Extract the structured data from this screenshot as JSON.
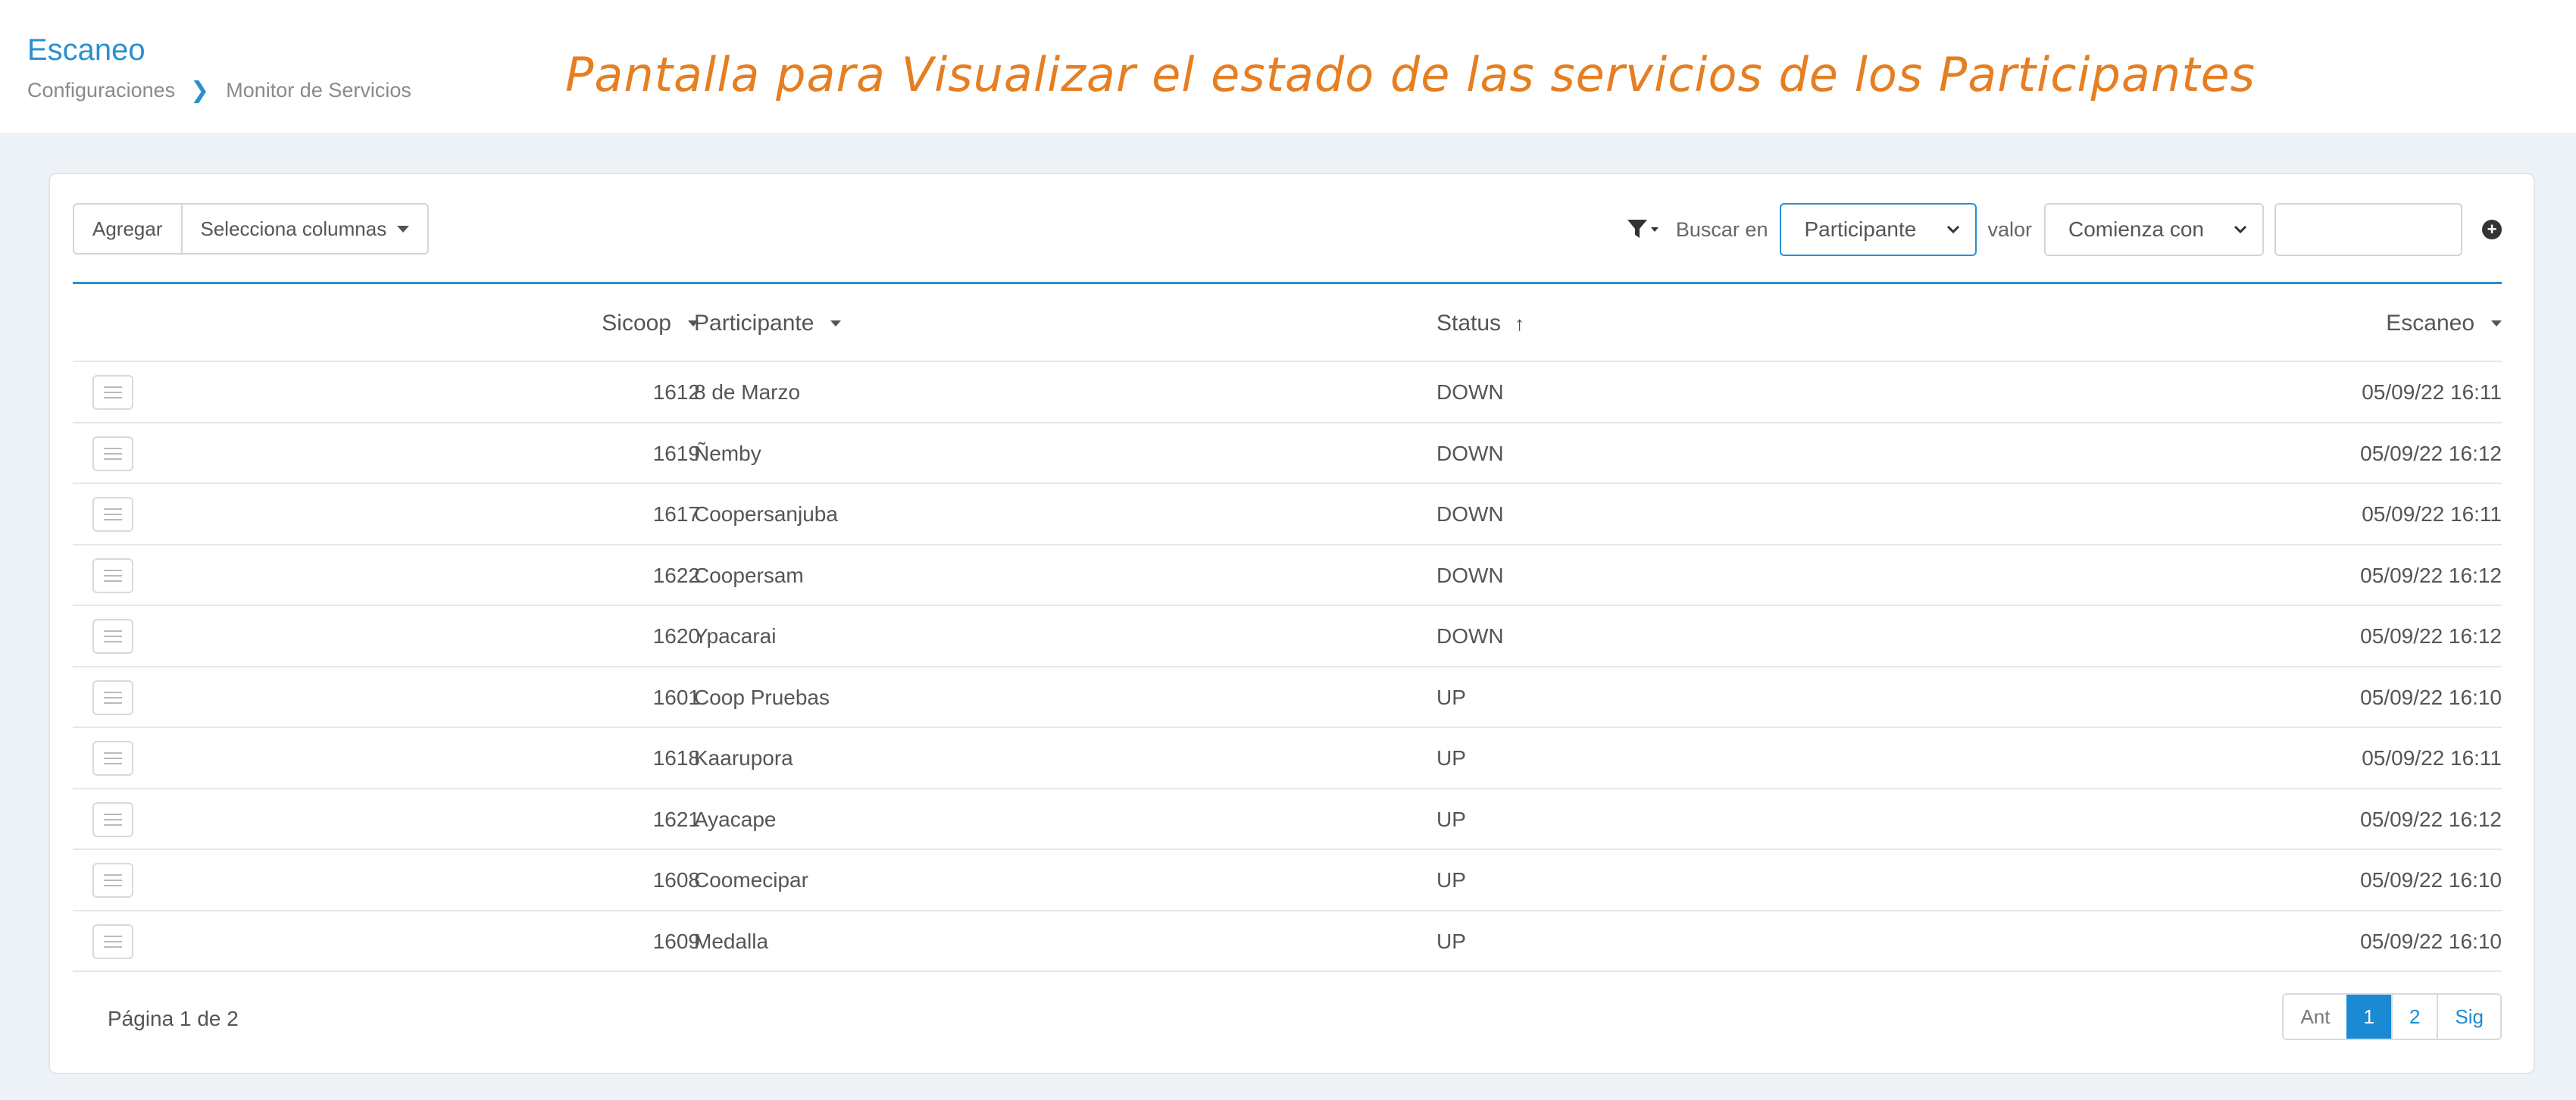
{
  "header": {
    "title": "Escaneo",
    "breadcrumb": [
      {
        "label": "Configuraciones"
      },
      {
        "label": "Monitor de Servicios"
      }
    ],
    "annotation": "Pantalla para Visualizar el estado de las servicios de los Participantes"
  },
  "toolbar": {
    "add_label": "Agregar",
    "columns_label": "Selecciona columnas",
    "search_in_label": "Buscar en",
    "search_field_value": "Participante",
    "value_label": "valor",
    "comparator_value": "Comienza con",
    "search_value": "",
    "icons": [
      "filter-icon",
      "chevron-down-icon",
      "plus-circle-icon"
    ]
  },
  "table": {
    "columns": [
      {
        "label": "Sicoop",
        "sort": "none"
      },
      {
        "label": "Participante",
        "sort": "none"
      },
      {
        "label": "Status",
        "sort": "asc"
      },
      {
        "label": "Escaneo",
        "sort": "none"
      }
    ],
    "rows": [
      {
        "sicoop": "1612",
        "participante": "8 de Marzo",
        "status": "DOWN",
        "escaneo": "05/09/22 16:11"
      },
      {
        "sicoop": "1619",
        "participante": "Ñemby",
        "status": "DOWN",
        "escaneo": "05/09/22 16:12"
      },
      {
        "sicoop": "1617",
        "participante": "Coopersanjuba",
        "status": "DOWN",
        "escaneo": "05/09/22 16:11"
      },
      {
        "sicoop": "1622",
        "participante": "Coopersam",
        "status": "DOWN",
        "escaneo": "05/09/22 16:12"
      },
      {
        "sicoop": "1620",
        "participante": "Ypacarai",
        "status": "DOWN",
        "escaneo": "05/09/22 16:12"
      },
      {
        "sicoop": "1601",
        "participante": "Coop Pruebas",
        "status": "UP",
        "escaneo": "05/09/22 16:10"
      },
      {
        "sicoop": "1618",
        "participante": "Kaarupora",
        "status": "UP",
        "escaneo": "05/09/22 16:11"
      },
      {
        "sicoop": "1621",
        "participante": "Ayacape",
        "status": "UP",
        "escaneo": "05/09/22 16:12"
      },
      {
        "sicoop": "1608",
        "participante": "Coomecipar",
        "status": "UP",
        "escaneo": "05/09/22 16:10"
      },
      {
        "sicoop": "1609",
        "participante": "Medalla",
        "status": "UP",
        "escaneo": "05/09/22 16:10"
      }
    ]
  },
  "pagination": {
    "info": "Página 1 de 2",
    "prev": "Ant",
    "pages": [
      "1",
      "2"
    ],
    "current": "1",
    "next": "Sig"
  },
  "colors": {
    "accent": "#2a8fd0",
    "annotation": "#e67e22",
    "background": "#edf2f7",
    "active_page": "#1a8ad4"
  }
}
